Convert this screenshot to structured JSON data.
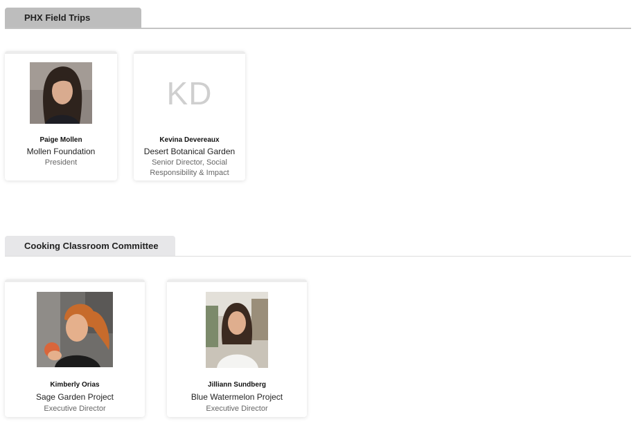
{
  "sections": [
    {
      "title": "PHX Field Trips",
      "people": [
        {
          "name": "Paige Mollen",
          "org": "Mollen Foundation",
          "role": "President",
          "photo": "portrait-photo"
        },
        {
          "name": "Kevina Devereaux",
          "org": "Desert Botanical Garden",
          "role": "Senior Director, Social Responsibility & Impact",
          "initials": "KD"
        }
      ]
    },
    {
      "title": "Cooking Classroom Committee",
      "people": [
        {
          "name": "Kimberly Orias",
          "org": "Sage Garden Project",
          "role": "Executive Director",
          "photo": "portrait-photo"
        },
        {
          "name": "Jilliann Sundberg",
          "org": "Blue Watermelon Project",
          "role": "Executive Director",
          "photo": "portrait-photo"
        }
      ]
    }
  ],
  "colors": {
    "tab_active": "#bdbdbd",
    "tab_inactive": "#e7e7e9",
    "initials": "#cfcfcf"
  }
}
